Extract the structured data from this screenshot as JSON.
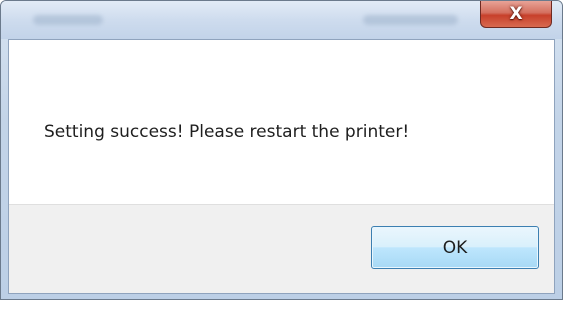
{
  "window": {
    "close_label": "X",
    "close_icon": "close-icon"
  },
  "dialog": {
    "message": "Setting success! Please restart the printer!",
    "ok_label": "OK"
  },
  "colors": {
    "close_button": "#c7402b",
    "ok_button_border": "#3c7fb1",
    "button_area": "#f0f0f0"
  }
}
